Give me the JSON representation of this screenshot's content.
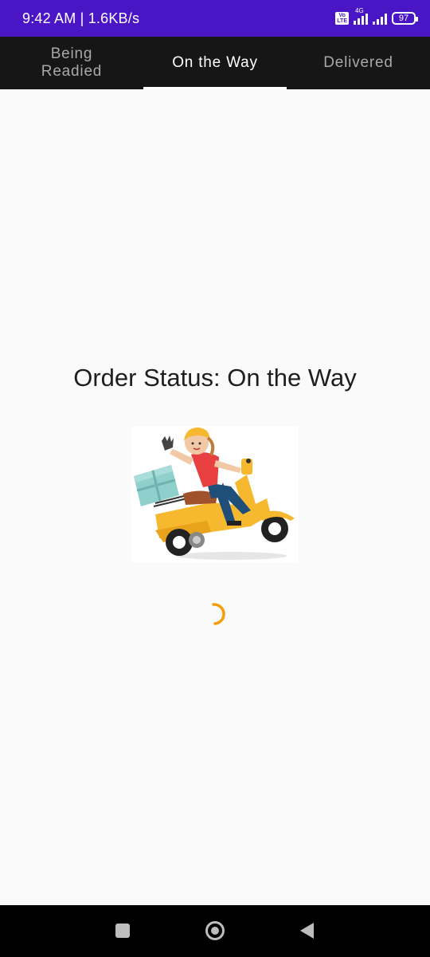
{
  "status_bar": {
    "time_speed": "9:42 AM | 1.6KB/s",
    "volte": "Vo\nLTE",
    "network": "4G",
    "battery": "97"
  },
  "tabs": [
    {
      "label": "Being\nReadied",
      "active": false
    },
    {
      "label": "On the Way",
      "active": true
    },
    {
      "label": "Delivered",
      "active": false
    }
  ],
  "main": {
    "title": "Order Status: On the Way"
  },
  "colors": {
    "status_bar": "#4a16c5",
    "tab_bar": "#161616",
    "spinner": "#f59e0b",
    "scooter": "#f5b82e"
  },
  "icons": {
    "nav_recents": "square-icon",
    "nav_home": "circle-icon",
    "nav_back": "triangle-back-icon"
  }
}
